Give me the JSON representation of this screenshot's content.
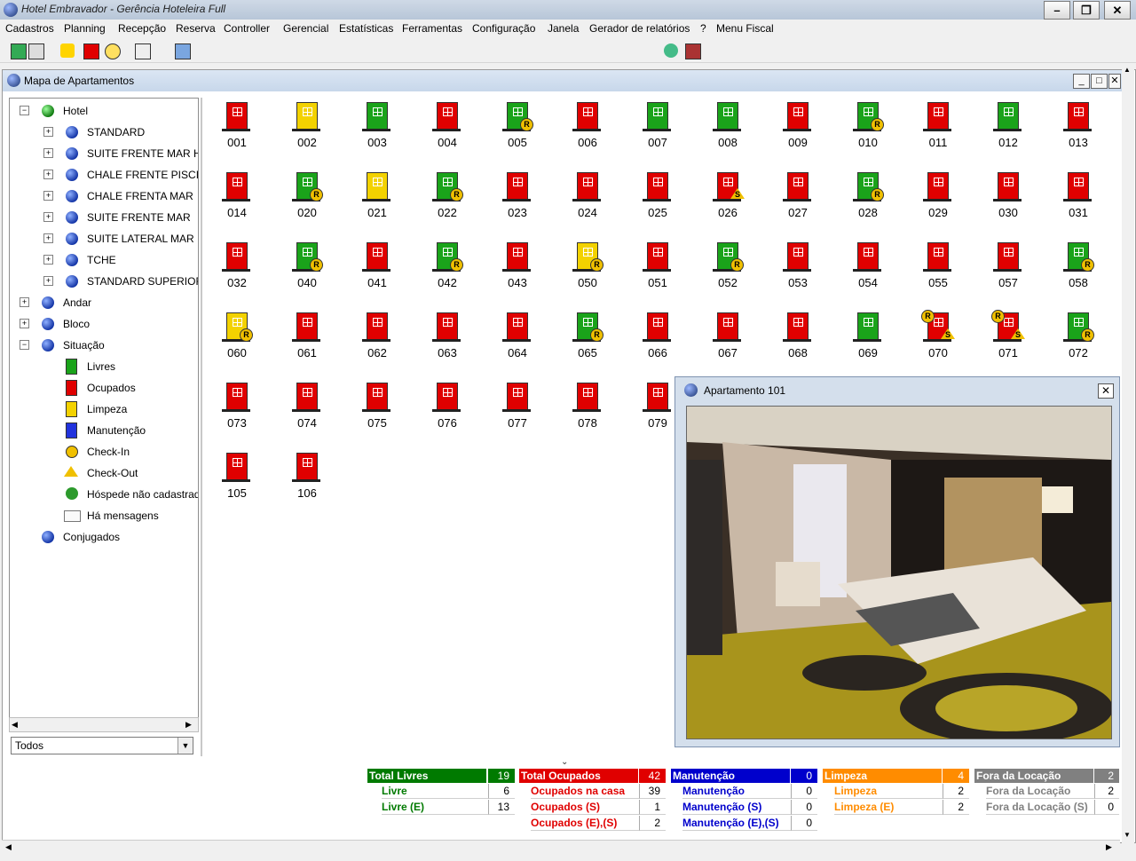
{
  "app": {
    "title": "Hotel Embravador - Gerência Hoteleira Full"
  },
  "menu": [
    "Cadastros",
    "Planning",
    "Recepção",
    "Reserva",
    "Controller",
    "Gerencial",
    "Estatísticas",
    "Ferramentas",
    "Configuração",
    "Janela",
    "Gerador de relatórios",
    "?",
    "Menu Fiscal"
  ],
  "child_window": {
    "title": "Mapa de Apartamentos"
  },
  "tree": {
    "root": "Hotel",
    "types": [
      "STANDARD",
      "SUITE FRENTE MAR HIDRO",
      "CHALE FRENTE PISCINA",
      "CHALE FRENTA MAR",
      "SUITE FRENTE MAR",
      "SUITE LATERAL MAR",
      "TCHE",
      "STANDARD SUPERIOR"
    ],
    "andar": "Andar",
    "bloco": "Bloco",
    "situacao": "Situação",
    "legend": [
      "Livres",
      "Ocupados",
      "Limpeza",
      "Manutenção",
      "Check-In",
      "Check-Out",
      "Hóspede não cadastrado",
      "Há mensagens"
    ],
    "conjugados": "Conjugados",
    "filter": "Todos"
  },
  "rooms": [
    {
      "n": "001",
      "s": "red"
    },
    {
      "n": "002",
      "s": "yellow"
    },
    {
      "n": "003",
      "s": "green"
    },
    {
      "n": "004",
      "s": "red"
    },
    {
      "n": "005",
      "s": "green",
      "r": true
    },
    {
      "n": "006",
      "s": "red"
    },
    {
      "n": "007",
      "s": "green"
    },
    {
      "n": "008",
      "s": "green"
    },
    {
      "n": "009",
      "s": "red"
    },
    {
      "n": "010",
      "s": "green",
      "r": true
    },
    {
      "n": "011",
      "s": "red"
    },
    {
      "n": "012",
      "s": "green"
    },
    {
      "n": "013",
      "s": "red"
    },
    {
      "n": "014",
      "s": "red"
    },
    {
      "n": "020",
      "s": "green",
      "r": true
    },
    {
      "n": "021",
      "s": "yellow"
    },
    {
      "n": "022",
      "s": "green",
      "r": true
    },
    {
      "n": "023",
      "s": "red"
    },
    {
      "n": "024",
      "s": "red"
    },
    {
      "n": "025",
      "s": "red"
    },
    {
      "n": "026",
      "s": "red",
      "sflag": true
    },
    {
      "n": "027",
      "s": "red"
    },
    {
      "n": "028",
      "s": "green",
      "r": true
    },
    {
      "n": "029",
      "s": "red"
    },
    {
      "n": "030",
      "s": "red"
    },
    {
      "n": "031",
      "s": "red"
    },
    {
      "n": "032",
      "s": "red"
    },
    {
      "n": "040",
      "s": "green",
      "r": true
    },
    {
      "n": "041",
      "s": "red"
    },
    {
      "n": "042",
      "s": "green",
      "r": true
    },
    {
      "n": "043",
      "s": "red"
    },
    {
      "n": "050",
      "s": "yellow",
      "r": true
    },
    {
      "n": "051",
      "s": "red"
    },
    {
      "n": "052",
      "s": "green",
      "r": true
    },
    {
      "n": "053",
      "s": "red"
    },
    {
      "n": "054",
      "s": "red"
    },
    {
      "n": "055",
      "s": "red"
    },
    {
      "n": "057",
      "s": "red"
    },
    {
      "n": "058",
      "s": "green",
      "r": true
    },
    {
      "n": "060",
      "s": "yellow",
      "r": true
    },
    {
      "n": "061",
      "s": "red"
    },
    {
      "n": "062",
      "s": "red"
    },
    {
      "n": "063",
      "s": "red"
    },
    {
      "n": "064",
      "s": "red"
    },
    {
      "n": "065",
      "s": "green",
      "r": true
    },
    {
      "n": "066",
      "s": "red"
    },
    {
      "n": "067",
      "s": "red"
    },
    {
      "n": "068",
      "s": "red"
    },
    {
      "n": "069",
      "s": "green"
    },
    {
      "n": "070",
      "s": "red",
      "rtop": true,
      "sflag": true
    },
    {
      "n": "071",
      "s": "red",
      "rtop": true,
      "sflag": true
    },
    {
      "n": "072",
      "s": "green",
      "r": true
    },
    {
      "n": "073",
      "s": "red"
    },
    {
      "n": "074",
      "s": "red"
    },
    {
      "n": "075",
      "s": "red"
    },
    {
      "n": "076",
      "s": "red"
    },
    {
      "n": "077",
      "s": "red"
    },
    {
      "n": "078",
      "s": "red"
    },
    {
      "n": "079",
      "s": "red"
    },
    {
      "n": "105",
      "s": "red"
    },
    {
      "n": "106",
      "s": "red"
    }
  ],
  "popup": {
    "title": "Apartamento 101"
  },
  "stats": {
    "livres": {
      "head": "Total Livres",
      "total": "19",
      "rows": [
        [
          "Livre",
          "6"
        ],
        [
          "Livre (E)",
          "13"
        ]
      ]
    },
    "ocupados": {
      "head": "Total Ocupados",
      "total": "42",
      "rows": [
        [
          "Ocupados na casa",
          "39"
        ],
        [
          "Ocupados (S)",
          "1"
        ],
        [
          "Ocupados (E),(S)",
          "2"
        ]
      ]
    },
    "manut": {
      "head": "Manutenção",
      "total": "0",
      "rows": [
        [
          "Manutenção",
          "0"
        ],
        [
          "Manutenção (S)",
          "0"
        ],
        [
          "Manutenção (E),(S)",
          "0"
        ]
      ]
    },
    "limpeza": {
      "head": "Limpeza",
      "total": "4",
      "rows": [
        [
          "Limpeza",
          "2"
        ],
        [
          "Limpeza (E)",
          "2"
        ]
      ]
    },
    "fora": {
      "head": "Fora da Locação",
      "total": "2",
      "rows": [
        [
          "Fora da Locação",
          "2"
        ],
        [
          "Fora da Locação (S)",
          "0"
        ]
      ]
    }
  },
  "colors": {
    "livres": "#007a00",
    "ocupados": "#e00000",
    "manut": "#0000cc",
    "limpeza": "#ff8c00",
    "fora": "#808080"
  }
}
